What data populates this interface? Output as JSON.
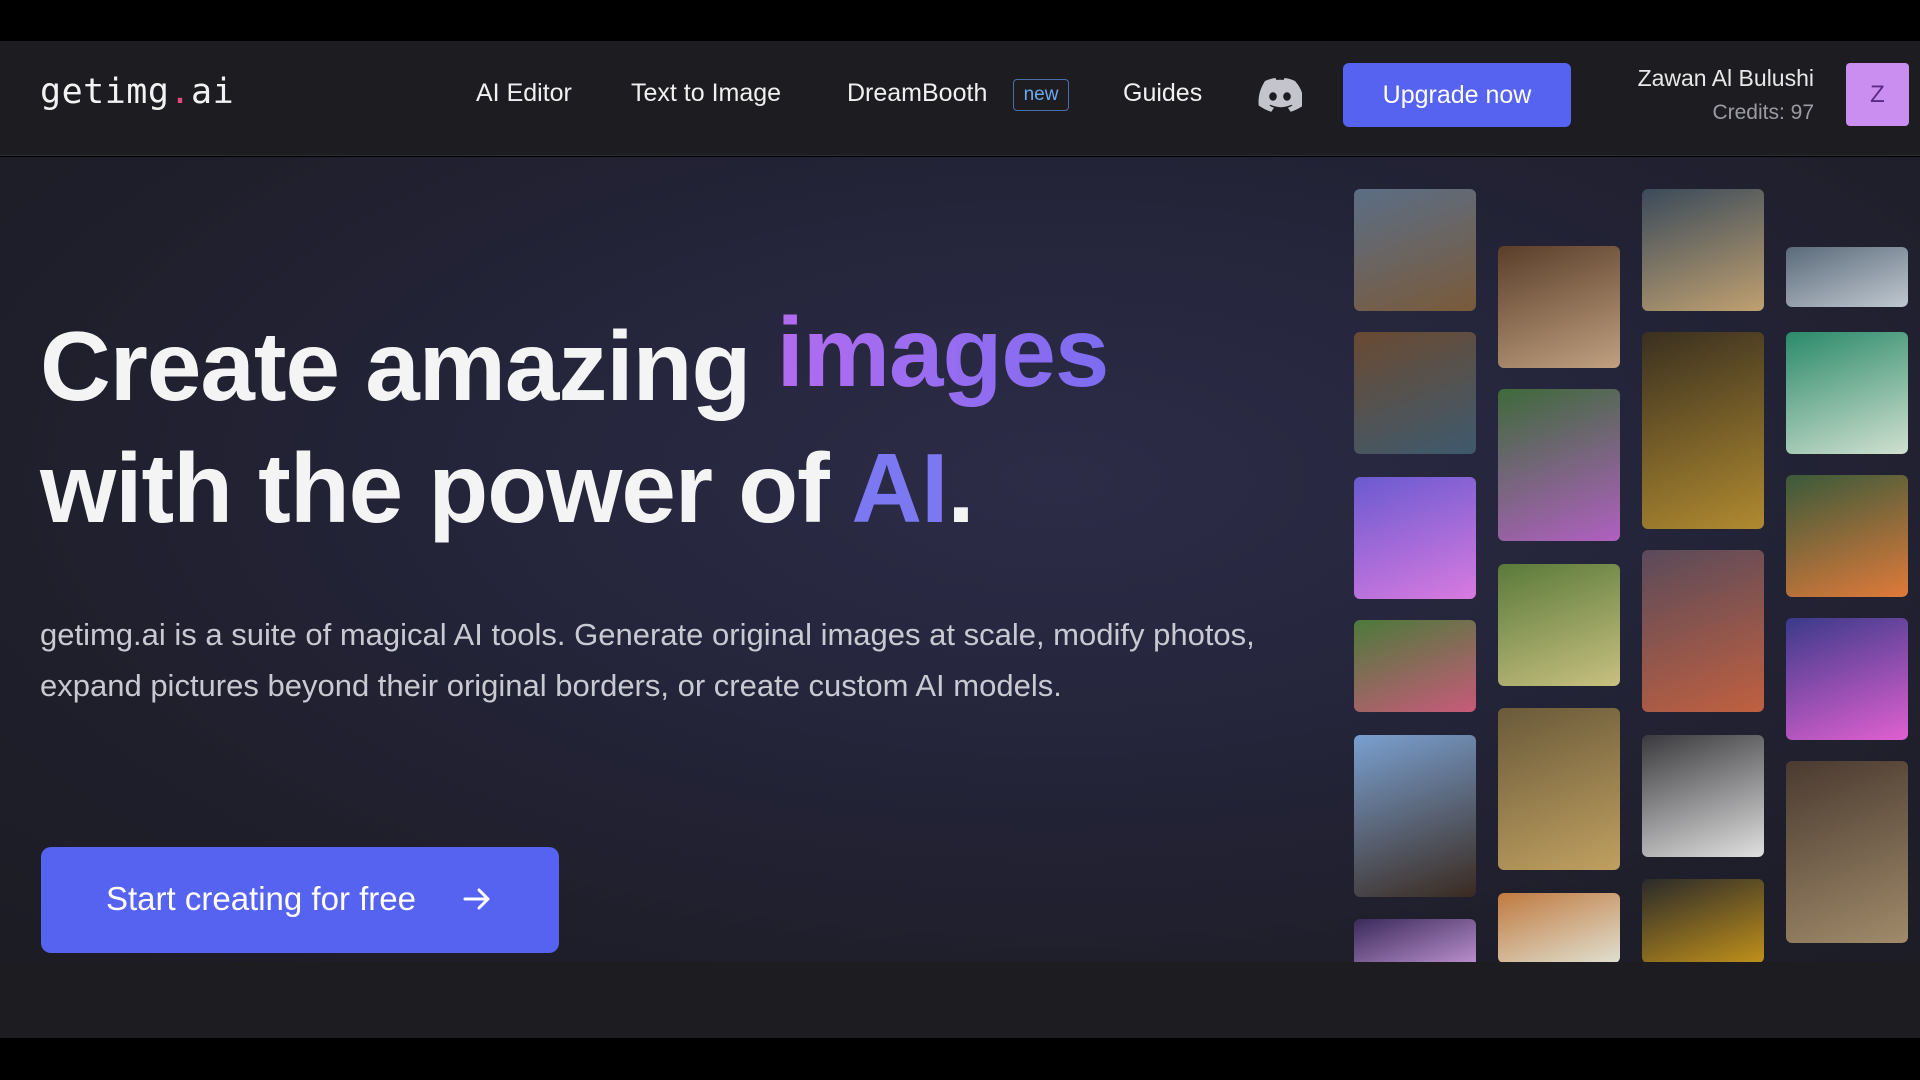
{
  "header": {
    "logo_main": "getimg",
    "logo_dot": ".",
    "logo_tail": "ai",
    "nav": {
      "ai_editor": "AI Editor",
      "text_to_image": "Text to Image",
      "dreambooth": "DreamBooth",
      "dreambooth_badge": "new",
      "guides": "Guides"
    },
    "discord_icon": "discord-icon",
    "upgrade_label": "Upgrade now",
    "user": {
      "name": "Zawan Al Bulushi",
      "credits": "Credits: 97",
      "avatar_initial": "Z"
    }
  },
  "hero": {
    "headline_part1": "Create amazing ",
    "headline_highlight1": "images",
    "headline_part2": "with the power of ",
    "headline_highlight2": "AI",
    "headline_end": ".",
    "description": "getimg.ai is a suite of magical AI tools. Generate original images at scale, modify photos, expand pictures beyond their original borders, or create custom AI models.",
    "cta_label": "Start creating for free",
    "cta_icon": "arrow-right-icon"
  },
  "colors": {
    "accent": "#5662f0",
    "highlight_purple": "#b26cf0",
    "highlight_blue": "#7b78f2",
    "avatar_bg": "#c98ef0",
    "logo_dot": "#e5487d"
  },
  "gallery": [
    {
      "name": "portrait-man-coat-tile",
      "colors": [
        "#5b6e86",
        "#7a5a3a"
      ]
    },
    {
      "name": "bedroom-forest-view-tile",
      "colors": [
        "#6a4a32",
        "#3e5a6e"
      ]
    },
    {
      "name": "fluffy-cat-tile",
      "colors": [
        "#6a5ad0",
        "#d87ae0"
      ]
    },
    {
      "name": "rose-garden-tile",
      "colors": [
        "#4c7a3a",
        "#c85a7a"
      ]
    },
    {
      "name": "horse-rider-tile",
      "colors": [
        "#7aa0d0",
        "#3a2a20"
      ]
    },
    {
      "name": "purple-moon-tile",
      "colors": [
        "#3a2a5a",
        "#d0a0e0"
      ]
    },
    {
      "name": "curly-hair-man-tile",
      "colors": [
        "#5a3e2a",
        "#c0a080"
      ]
    },
    {
      "name": "flower-goddess-tile",
      "colors": [
        "#3e6a3a",
        "#b060c0"
      ]
    },
    {
      "name": "tree-meadow-tile",
      "colors": [
        "#5a7a3a",
        "#c8c080"
      ]
    },
    {
      "name": "stone-pyramid-tile",
      "colors": [
        "#6a5a3a",
        "#c0a060"
      ]
    },
    {
      "name": "cathedral-arches-tile",
      "colors": [
        "#c07a40",
        "#e0e0d0"
      ]
    },
    {
      "name": "stormy-sea-tile",
      "colors": [
        "#3a4a5a",
        "#c0a070"
      ]
    },
    {
      "name": "golden-skull-tile",
      "colors": [
        "#3a3020",
        "#b08a30"
      ]
    },
    {
      "name": "mushroom-forest-tile",
      "colors": [
        "#5a4a5a",
        "#c06040"
      ]
    },
    {
      "name": "glowing-sneaker-tile",
      "colors": [
        "#3a3a3e",
        "#e0e0e0"
      ]
    },
    {
      "name": "golden-mushroom-tile",
      "colors": [
        "#2a2a2a",
        "#c0901a"
      ]
    },
    {
      "name": "clouds-sky-tile",
      "colors": [
        "#5a6a7a",
        "#c0c8d0"
      ]
    },
    {
      "name": "green-hair-girl-tile",
      "colors": [
        "#2a8a6a",
        "#d0e0d0"
      ]
    },
    {
      "name": "koi-pond-tile",
      "colors": [
        "#3a5a3a",
        "#e07a3a"
      ]
    },
    {
      "name": "neon-hamster-tile",
      "colors": [
        "#3a3a8a",
        "#e060d0"
      ]
    },
    {
      "name": "armored-elder-tile",
      "colors": [
        "#4a3a30",
        "#a08a6a"
      ]
    }
  ]
}
